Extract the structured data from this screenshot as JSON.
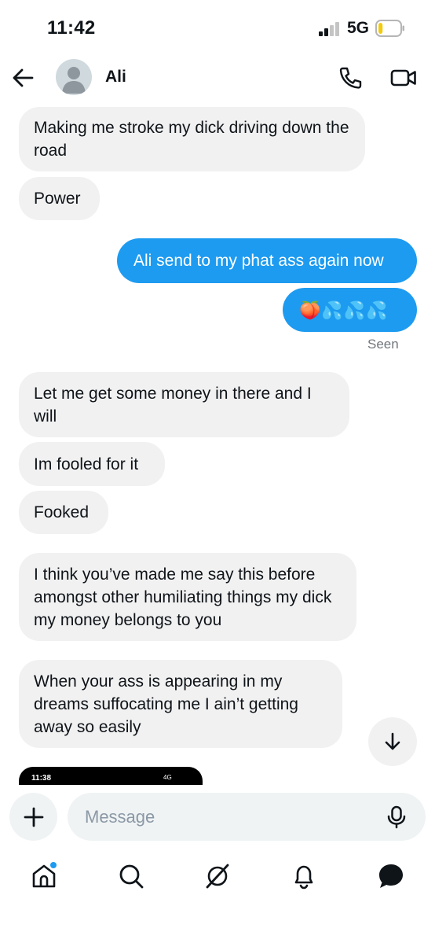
{
  "status_bar": {
    "time": "11:42",
    "network": "5G",
    "battery_level": 0.2
  },
  "header": {
    "contact_name": "Ali"
  },
  "messages": [
    {
      "direction": "in",
      "text": "Making me stroke my dick driving down the road"
    },
    {
      "direction": "in",
      "text": "Power"
    },
    {
      "direction": "out",
      "text": "Ali send to my phat ass again now"
    },
    {
      "direction": "out",
      "text": "🍑💦💦💦"
    },
    {
      "direction": "in",
      "text": "Let me get some money in there and I will"
    },
    {
      "direction": "in",
      "text": "Im fooled for it"
    },
    {
      "direction": "in",
      "text": "Fooked"
    },
    {
      "direction": "in",
      "text": "I think you’ve made me say this before amongst other humiliating things my dick my money belongs to you"
    },
    {
      "direction": "in",
      "text": "When your ass is appearing in my dreams suffocating me I ain’t getting away so easily"
    }
  ],
  "read_receipt": "Seen",
  "preview": {
    "time": "11:38",
    "network": "4G"
  },
  "composer": {
    "placeholder": "Message"
  },
  "tabbar": {
    "items": [
      "home-icon",
      "search-icon",
      "grok-icon",
      "notifications-icon",
      "messages-icon"
    ],
    "has_notification_dot": true
  },
  "colors": {
    "accent": "#1d9bf0",
    "incoming_bubble": "#f1f1f1",
    "text": "#0f1419",
    "muted": "#71767b"
  }
}
